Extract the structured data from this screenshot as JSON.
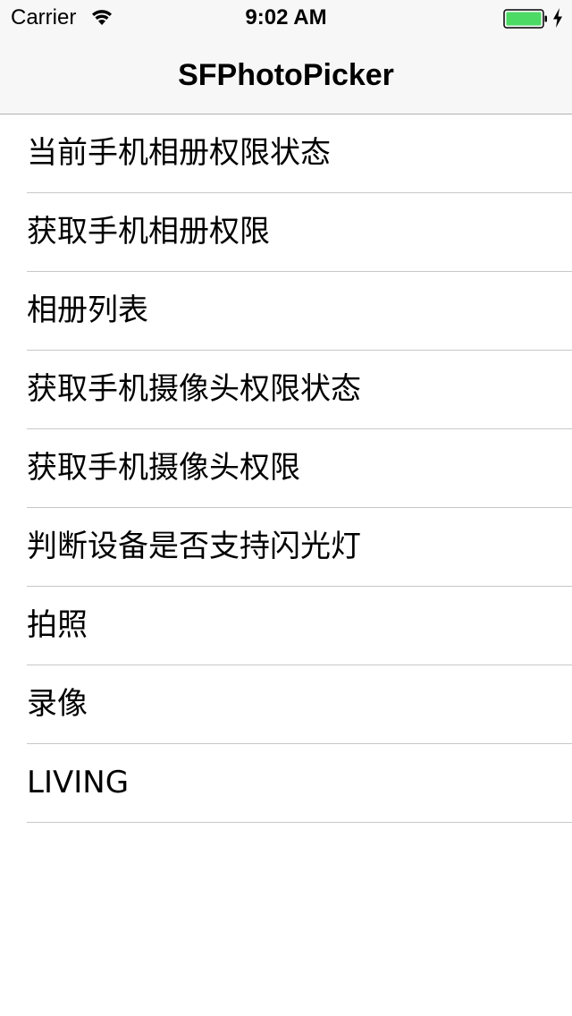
{
  "status_bar": {
    "carrier": "Carrier",
    "time": "9:02 AM",
    "battery_color": "#4cd964"
  },
  "nav_bar": {
    "title": "SFPhotoPicker"
  },
  "table": {
    "rows": [
      {
        "label": "当前手机相册权限状态"
      },
      {
        "label": "获取手机相册权限"
      },
      {
        "label": "相册列表"
      },
      {
        "label": "获取手机摄像头权限状态"
      },
      {
        "label": "获取手机摄像头权限"
      },
      {
        "label": "判断设备是否支持闪光灯"
      },
      {
        "label": "拍照"
      },
      {
        "label": "录像"
      },
      {
        "label": "LIVING"
      }
    ]
  }
}
